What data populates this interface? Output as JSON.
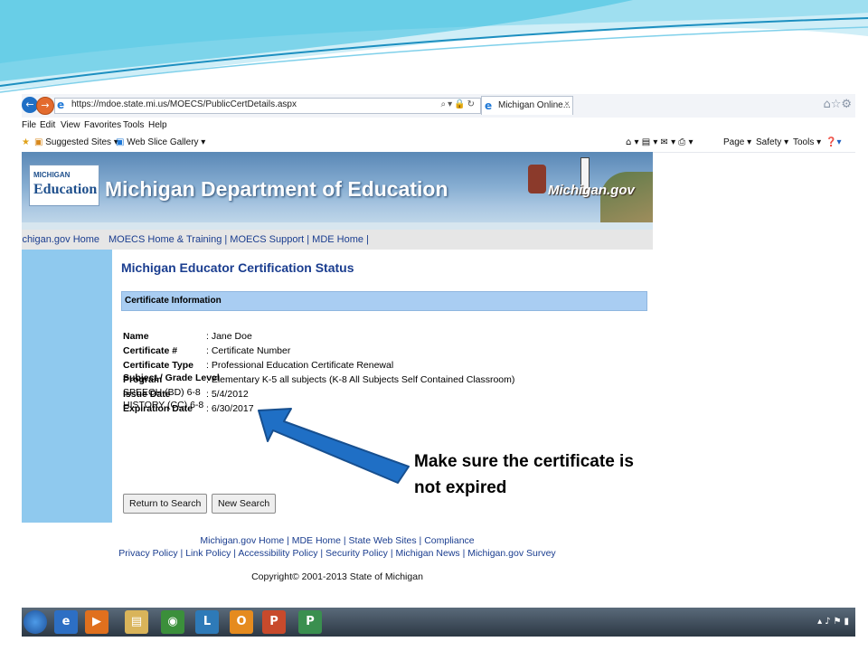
{
  "browser": {
    "url": "https://mdoe.state.mi.us/MOECS/PublicCertDetails.aspx",
    "tab_title": "Michigan Online...",
    "tab_close": "×",
    "menu": [
      "File",
      "Edit",
      "View",
      "Favorites",
      "Tools",
      "Help"
    ],
    "favorites": [
      "Suggested Sites ▾",
      "Web Slice Gallery ▾"
    ],
    "command_bar": [
      "Page ▾",
      "Safety ▾",
      "Tools ▾"
    ]
  },
  "banner": {
    "logo_small": "MICHIGAN",
    "logo_big": "Education",
    "title": "Michigan Department of Education",
    "mi_logo": "Michigan.gov"
  },
  "nav_links": {
    "left": "ichigan.gov Home",
    "right": "MOECS Home & Training | MOECS Support | MDE Home |"
  },
  "page": {
    "title": "Michigan Educator Certification Status",
    "section": "Certificate Information",
    "fields": [
      {
        "label": "Name",
        "value": ": Jane Doe"
      },
      {
        "label": "Certificate #",
        "value": ": Certificate Number"
      },
      {
        "label": "Certificate Type",
        "value": ": Professional Education Certificate Renewal"
      },
      {
        "label": "Program",
        "value": ": Elementary K-5 all subjects (K-8 All Subjects Self Contained Classroom)"
      },
      {
        "label": "Issue Date",
        "value": ": 5/4/2012"
      },
      {
        "label": "Expiration Date",
        "value": ": 6/30/2017"
      }
    ],
    "subject_heading": "Subject / Grade Level",
    "subjects": [
      "SPEECH (BD) 6-8",
      "HISTORY (CC) 6-8"
    ],
    "buttons": {
      "return": "Return to Search",
      "new": "New Search"
    }
  },
  "footer": {
    "line1": "Michigan.gov Home | MDE Home | State Web Sites | Compliance",
    "line2": "Privacy Policy | Link Policy | Accessibility Policy | Security Policy | Michigan News | Michigan.gov Survey",
    "copyright": "Copyright© 2001-2013 State of Michigan"
  },
  "callout": {
    "line1": "Make sure the certificate is",
    "line2": "not expired",
    "arrow_color": "#1f6fc5"
  }
}
